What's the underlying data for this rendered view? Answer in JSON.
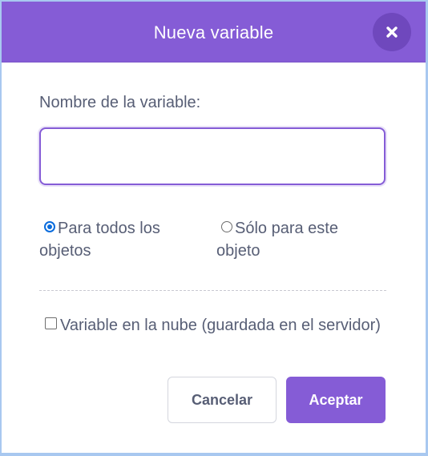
{
  "dialog": {
    "title": "Nueva variable",
    "close_icon": "close-icon",
    "name_label": "Nombre de la variable:",
    "name_value": "",
    "name_placeholder": "",
    "scope_options": [
      {
        "label": "Para todos los objetos",
        "checked": true
      },
      {
        "label": "Sólo para este objeto",
        "checked": false
      }
    ],
    "cloud_label": "Variable en la nube (guardada en el servidor)",
    "cloud_checked": false,
    "cancel_label": "Cancelar",
    "ok_label": "Aceptar"
  },
  "colors": {
    "accent": "#855cd6",
    "close_bg": "#6f48bd",
    "text": "#575e75",
    "radio_selected": "#0a6cdd"
  }
}
